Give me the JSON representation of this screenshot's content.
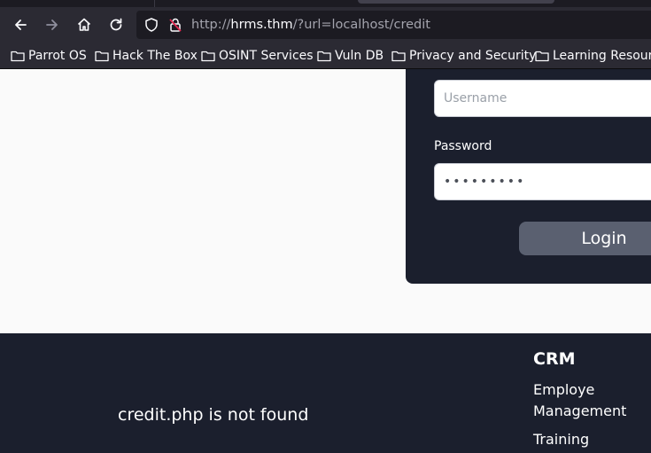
{
  "browser": {
    "url_prefix": "http://",
    "url_host": "hrms.thm",
    "url_path": "/?url=localhost/credit",
    "icons": [
      "back-icon",
      "forward-icon",
      "home-icon",
      "reload-icon",
      "shield-icon",
      "lock-warning-icon"
    ]
  },
  "bookmarks": [
    {
      "label": "Parrot OS"
    },
    {
      "label": "Hack The Box"
    },
    {
      "label": "OSINT Services"
    },
    {
      "label": "Vuln DB"
    },
    {
      "label": "Privacy and Security"
    },
    {
      "label": "Learning Resourc"
    }
  ],
  "login": {
    "username_placeholder": "Username",
    "password_label": "Password",
    "password_value": "•••••••••",
    "login_label": "Login"
  },
  "footer": {
    "message": "credit.php is not found",
    "heading": "CRM",
    "link1": "Employe Management",
    "link2": "Training"
  },
  "colors": {
    "chrome_bg": "#2b2a33",
    "urlbar_bg": "#1c1b22",
    "page_bg": "#fafafa",
    "dark_panel": "#1b1f2d",
    "login_button": "#5a6070"
  }
}
